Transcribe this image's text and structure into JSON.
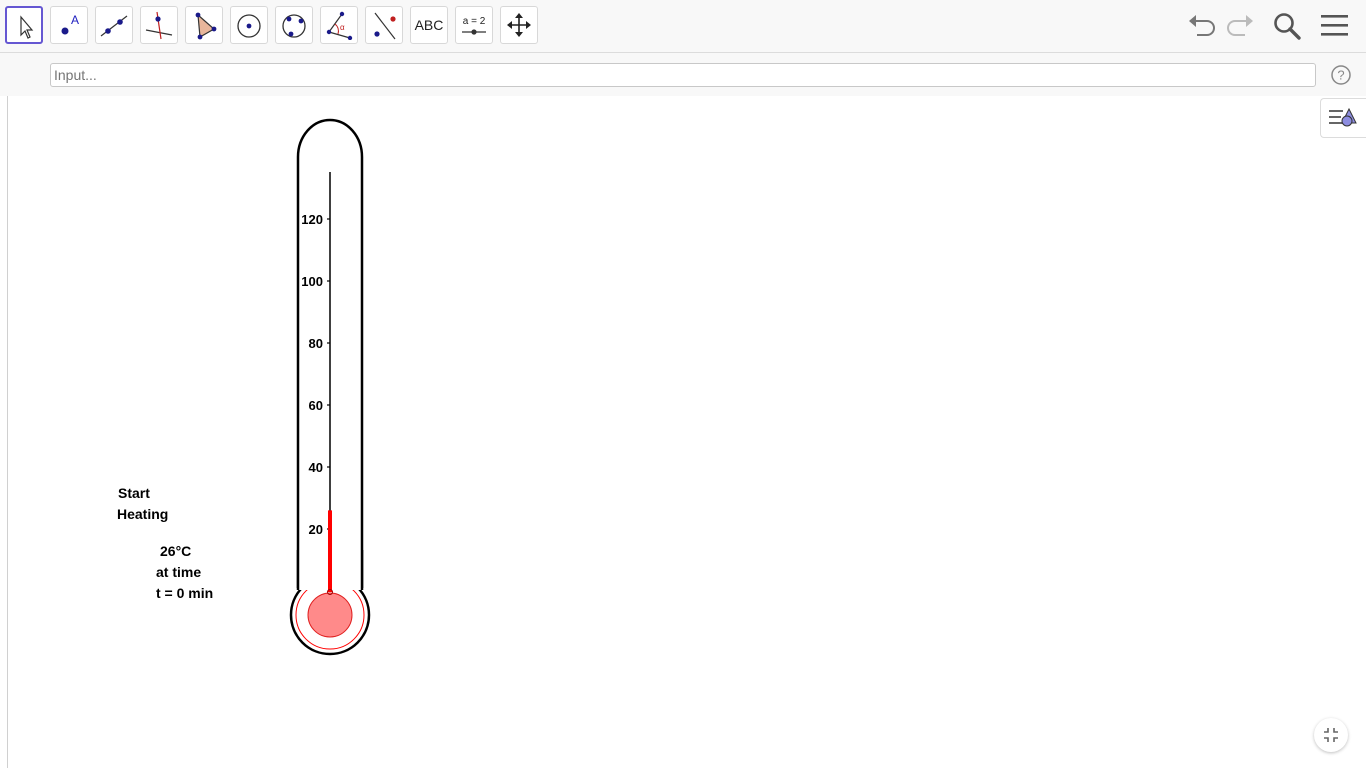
{
  "toolbar": {
    "tools": [
      {
        "name": "move-tool",
        "selected": true
      },
      {
        "name": "point-tool",
        "label": "A"
      },
      {
        "name": "line-tool"
      },
      {
        "name": "perpendicular-line-tool"
      },
      {
        "name": "polygon-tool"
      },
      {
        "name": "circle-tool"
      },
      {
        "name": "circle-through-three-points-tool"
      },
      {
        "name": "angle-tool",
        "label": "α"
      },
      {
        "name": "reflect-tool"
      },
      {
        "name": "text-tool",
        "label": "ABC"
      },
      {
        "name": "slider-tool",
        "label": "a = 2"
      },
      {
        "name": "move-graphics-view-tool"
      }
    ]
  },
  "input": {
    "placeholder": "Input..."
  },
  "help": {
    "label": "?"
  },
  "graphics": {
    "start_label_line1": "Start",
    "start_label_line2": "Heating",
    "temp_line1": "26°C",
    "temp_line2": "at time",
    "temp_line3": "t = 0 min"
  },
  "thermometer": {
    "ticks": [
      "20",
      "40",
      "60",
      "80",
      "100",
      "120"
    ],
    "temperature": 26,
    "mercury_color": "#ff0000",
    "bulb_color": "#ff8a8a"
  },
  "colors": {
    "accent": "#6557d2",
    "toolbar_bg": "#f8f8f8"
  }
}
